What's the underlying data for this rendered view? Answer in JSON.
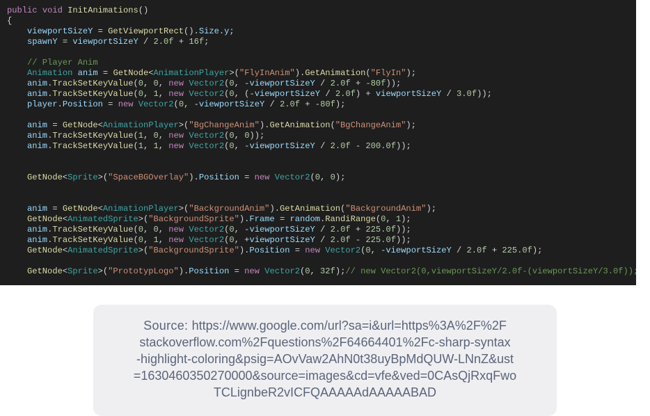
{
  "code": {
    "method_sig": {
      "mod": "public",
      "ret": "void",
      "name": "InitAnimations"
    },
    "lines": [
      {
        "i": 0,
        "t": "sig"
      },
      {
        "i": 0,
        "t": "brace_open"
      },
      {
        "i": 1,
        "t": "assign",
        "lhs": "viewportSizeY",
        "rhs": [
          [
            "fn",
            "GetViewportRect"
          ],
          [
            "pun",
            "()."
          ],
          [
            "var",
            "Size"
          ],
          [
            "pun",
            "."
          ],
          [
            "var",
            "y"
          ],
          [
            "pun",
            ";"
          ]
        ]
      },
      {
        "i": 1,
        "t": "assign",
        "lhs": "spawnY",
        "rhs": [
          [
            "var",
            "viewportSizeY"
          ],
          [
            "pun",
            " / "
          ],
          [
            "num",
            "2.0f"
          ],
          [
            "pun",
            " + "
          ],
          [
            "num",
            "16f"
          ],
          [
            "pun",
            ";"
          ]
        ]
      },
      {
        "i": 1,
        "t": "blank"
      },
      {
        "i": 1,
        "t": "comment",
        "text": "// Player Anim"
      },
      {
        "i": 1,
        "t": "raw",
        "tok": [
          [
            "type",
            "Animation"
          ],
          [
            "pun",
            " "
          ],
          [
            "var",
            "anim"
          ],
          [
            "pun",
            " = "
          ],
          [
            "fn",
            "GetNode"
          ],
          [
            "pun",
            "<"
          ],
          [
            "type",
            "AnimationPlayer"
          ],
          [
            "pun",
            ">("
          ],
          [
            "str",
            "\"FlyInAnim\""
          ],
          [
            "pun",
            ")."
          ],
          [
            "fn",
            "GetAnimation"
          ],
          [
            "pun",
            "("
          ],
          [
            "str",
            "\"FlyIn\""
          ],
          [
            "pun",
            ");"
          ]
        ]
      },
      {
        "i": 1,
        "t": "raw",
        "tok": [
          [
            "var",
            "anim"
          ],
          [
            "pun",
            "."
          ],
          [
            "fn",
            "TrackSetKeyValue"
          ],
          [
            "pun",
            "("
          ],
          [
            "num",
            "0"
          ],
          [
            "pun",
            ", "
          ],
          [
            "num",
            "0"
          ],
          [
            "pun",
            ", "
          ],
          [
            "kw",
            "new"
          ],
          [
            "pun",
            " "
          ],
          [
            "type",
            "Vector2"
          ],
          [
            "pun",
            "("
          ],
          [
            "num",
            "0"
          ],
          [
            "pun",
            ", -"
          ],
          [
            "var",
            "viewportSizeY"
          ],
          [
            "pun",
            " / "
          ],
          [
            "num",
            "2.0f"
          ],
          [
            "pun",
            " + -"
          ],
          [
            "num",
            "80f"
          ],
          [
            "pun",
            "));"
          ]
        ]
      },
      {
        "i": 1,
        "t": "raw",
        "tok": [
          [
            "var",
            "anim"
          ],
          [
            "pun",
            "."
          ],
          [
            "fn",
            "TrackSetKeyValue"
          ],
          [
            "pun",
            "("
          ],
          [
            "num",
            "0"
          ],
          [
            "pun",
            ", "
          ],
          [
            "num",
            "1"
          ],
          [
            "pun",
            ", "
          ],
          [
            "kw",
            "new"
          ],
          [
            "pun",
            " "
          ],
          [
            "type",
            "Vector2"
          ],
          [
            "pun",
            "("
          ],
          [
            "num",
            "0"
          ],
          [
            "pun",
            ", (-"
          ],
          [
            "var",
            "viewportSizeY"
          ],
          [
            "pun",
            " / "
          ],
          [
            "num",
            "2.0f"
          ],
          [
            "pun",
            ") + "
          ],
          [
            "var",
            "viewportSizeY"
          ],
          [
            "pun",
            " / "
          ],
          [
            "num",
            "3.0f"
          ],
          [
            "pun",
            "));"
          ]
        ]
      },
      {
        "i": 1,
        "t": "raw",
        "tok": [
          [
            "var",
            "player"
          ],
          [
            "pun",
            "."
          ],
          [
            "var",
            "Position"
          ],
          [
            "pun",
            " = "
          ],
          [
            "kw",
            "new"
          ],
          [
            "pun",
            " "
          ],
          [
            "type",
            "Vector2"
          ],
          [
            "pun",
            "("
          ],
          [
            "num",
            "0"
          ],
          [
            "pun",
            ", -"
          ],
          [
            "var",
            "viewportSizeY"
          ],
          [
            "pun",
            " / "
          ],
          [
            "num",
            "2.0f"
          ],
          [
            "pun",
            " + -"
          ],
          [
            "num",
            "80f"
          ],
          [
            "pun",
            ");"
          ]
        ]
      },
      {
        "i": 1,
        "t": "blank"
      },
      {
        "i": 1,
        "t": "raw",
        "tok": [
          [
            "var",
            "anim"
          ],
          [
            "pun",
            " = "
          ],
          [
            "fn",
            "GetNode"
          ],
          [
            "pun",
            "<"
          ],
          [
            "type",
            "AnimationPlayer"
          ],
          [
            "pun",
            ">("
          ],
          [
            "str",
            "\"BgChangeAnim\""
          ],
          [
            "pun",
            ")."
          ],
          [
            "fn",
            "GetAnimation"
          ],
          [
            "pun",
            "("
          ],
          [
            "str",
            "\"BgChangeAnim\""
          ],
          [
            "pun",
            ");"
          ]
        ]
      },
      {
        "i": 1,
        "t": "raw",
        "tok": [
          [
            "var",
            "anim"
          ],
          [
            "pun",
            "."
          ],
          [
            "fn",
            "TrackSetKeyValue"
          ],
          [
            "pun",
            "("
          ],
          [
            "num",
            "1"
          ],
          [
            "pun",
            ", "
          ],
          [
            "num",
            "0"
          ],
          [
            "pun",
            ", "
          ],
          [
            "kw",
            "new"
          ],
          [
            "pun",
            " "
          ],
          [
            "type",
            "Vector2"
          ],
          [
            "pun",
            "("
          ],
          [
            "num",
            "0"
          ],
          [
            "pun",
            ", "
          ],
          [
            "num",
            "0"
          ],
          [
            "pun",
            "));"
          ]
        ]
      },
      {
        "i": 1,
        "t": "raw",
        "tok": [
          [
            "var",
            "anim"
          ],
          [
            "pun",
            "."
          ],
          [
            "fn",
            "TrackSetKeyValue"
          ],
          [
            "pun",
            "("
          ],
          [
            "num",
            "1"
          ],
          [
            "pun",
            ", "
          ],
          [
            "num",
            "1"
          ],
          [
            "pun",
            ", "
          ],
          [
            "kw",
            "new"
          ],
          [
            "pun",
            " "
          ],
          [
            "type",
            "Vector2"
          ],
          [
            "pun",
            "("
          ],
          [
            "num",
            "0"
          ],
          [
            "pun",
            ", -"
          ],
          [
            "var",
            "viewportSizeY"
          ],
          [
            "pun",
            " / "
          ],
          [
            "num",
            "2.0f"
          ],
          [
            "pun",
            " - "
          ],
          [
            "num",
            "200.0f"
          ],
          [
            "pun",
            "));"
          ]
        ]
      },
      {
        "i": 1,
        "t": "blank"
      },
      {
        "i": 1,
        "t": "blank"
      },
      {
        "i": 1,
        "t": "raw",
        "tok": [
          [
            "fn",
            "GetNode"
          ],
          [
            "pun",
            "<"
          ],
          [
            "type",
            "Sprite"
          ],
          [
            "pun",
            ">("
          ],
          [
            "str",
            "\"SpaceBGOverlay\""
          ],
          [
            "pun",
            ")."
          ],
          [
            "var",
            "Position"
          ],
          [
            "pun",
            " = "
          ],
          [
            "kw",
            "new"
          ],
          [
            "pun",
            " "
          ],
          [
            "type",
            "Vector2"
          ],
          [
            "pun",
            "("
          ],
          [
            "num",
            "0"
          ],
          [
            "pun",
            ", "
          ],
          [
            "num",
            "0"
          ],
          [
            "pun",
            ");"
          ]
        ]
      },
      {
        "i": 1,
        "t": "blank"
      },
      {
        "i": 1,
        "t": "blank"
      },
      {
        "i": 1,
        "t": "raw",
        "tok": [
          [
            "var",
            "anim"
          ],
          [
            "pun",
            " = "
          ],
          [
            "fn",
            "GetNode"
          ],
          [
            "pun",
            "<"
          ],
          [
            "type",
            "AnimationPlayer"
          ],
          [
            "pun",
            ">("
          ],
          [
            "str",
            "\"BackgroundAnim\""
          ],
          [
            "pun",
            ")."
          ],
          [
            "fn",
            "GetAnimation"
          ],
          [
            "pun",
            "("
          ],
          [
            "str",
            "\"BackgroundAnim\""
          ],
          [
            "pun",
            ");"
          ]
        ]
      },
      {
        "i": 1,
        "t": "raw",
        "tok": [
          [
            "fn",
            "GetNode"
          ],
          [
            "pun",
            "<"
          ],
          [
            "type",
            "AnimatedSprite"
          ],
          [
            "pun",
            ">("
          ],
          [
            "str",
            "\"BackgroundSprite\""
          ],
          [
            "pun",
            ")."
          ],
          [
            "var",
            "Frame"
          ],
          [
            "pun",
            " = "
          ],
          [
            "var",
            "random"
          ],
          [
            "pun",
            "."
          ],
          [
            "fn",
            "RandiRange"
          ],
          [
            "pun",
            "("
          ],
          [
            "num",
            "0"
          ],
          [
            "pun",
            ", "
          ],
          [
            "num",
            "1"
          ],
          [
            "pun",
            ");"
          ]
        ]
      },
      {
        "i": 1,
        "t": "raw",
        "tok": [
          [
            "var",
            "anim"
          ],
          [
            "pun",
            "."
          ],
          [
            "fn",
            "TrackSetKeyValue"
          ],
          [
            "pun",
            "("
          ],
          [
            "num",
            "0"
          ],
          [
            "pun",
            ", "
          ],
          [
            "num",
            "0"
          ],
          [
            "pun",
            ", "
          ],
          [
            "kw",
            "new"
          ],
          [
            "pun",
            " "
          ],
          [
            "type",
            "Vector2"
          ],
          [
            "pun",
            "("
          ],
          [
            "num",
            "0"
          ],
          [
            "pun",
            ", -"
          ],
          [
            "var",
            "viewportSizeY"
          ],
          [
            "pun",
            " / "
          ],
          [
            "num",
            "2.0f"
          ],
          [
            "pun",
            " + "
          ],
          [
            "num",
            "225.0f"
          ],
          [
            "pun",
            "));"
          ]
        ]
      },
      {
        "i": 1,
        "t": "raw",
        "tok": [
          [
            "var",
            "anim"
          ],
          [
            "pun",
            "."
          ],
          [
            "fn",
            "TrackSetKeyValue"
          ],
          [
            "pun",
            "("
          ],
          [
            "num",
            "0"
          ],
          [
            "pun",
            ", "
          ],
          [
            "num",
            "1"
          ],
          [
            "pun",
            ", "
          ],
          [
            "kw",
            "new"
          ],
          [
            "pun",
            " "
          ],
          [
            "type",
            "Vector2"
          ],
          [
            "pun",
            "("
          ],
          [
            "num",
            "0"
          ],
          [
            "pun",
            ", +"
          ],
          [
            "var",
            "viewportSizeY"
          ],
          [
            "pun",
            " / "
          ],
          [
            "num",
            "2.0f"
          ],
          [
            "pun",
            " - "
          ],
          [
            "num",
            "225.0f"
          ],
          [
            "pun",
            "));"
          ]
        ]
      },
      {
        "i": 1,
        "t": "raw",
        "tok": [
          [
            "fn",
            "GetNode"
          ],
          [
            "pun",
            "<"
          ],
          [
            "type",
            "AnimatedSprite"
          ],
          [
            "pun",
            ">("
          ],
          [
            "str",
            "\"BackgroundSprite\""
          ],
          [
            "pun",
            ")."
          ],
          [
            "var",
            "Position"
          ],
          [
            "pun",
            " = "
          ],
          [
            "kw",
            "new"
          ],
          [
            "pun",
            " "
          ],
          [
            "type",
            "Vector2"
          ],
          [
            "pun",
            "("
          ],
          [
            "num",
            "0"
          ],
          [
            "pun",
            ", -"
          ],
          [
            "var",
            "viewportSizeY"
          ],
          [
            "pun",
            " / "
          ],
          [
            "num",
            "2.0f"
          ],
          [
            "pun",
            " + "
          ],
          [
            "num",
            "225.0f"
          ],
          [
            "pun",
            ");"
          ]
        ]
      },
      {
        "i": 1,
        "t": "blank"
      },
      {
        "i": 1,
        "t": "raw",
        "tok": [
          [
            "fn",
            "GetNode"
          ],
          [
            "pun",
            "<"
          ],
          [
            "type",
            "Sprite"
          ],
          [
            "pun",
            ">("
          ],
          [
            "str",
            "\"PrototypLogo\""
          ],
          [
            "pun",
            ")."
          ],
          [
            "var",
            "Position"
          ],
          [
            "pun",
            " = "
          ],
          [
            "kw",
            "new"
          ],
          [
            "pun",
            " "
          ],
          [
            "type",
            "Vector2"
          ],
          [
            "pun",
            "("
          ],
          [
            "num",
            "0"
          ],
          [
            "pun",
            ", "
          ],
          [
            "num",
            "32f"
          ],
          [
            "pun",
            ");"
          ],
          [
            "com",
            "// new Vector2(0,viewportSizeY/2.0f-(viewportSizeY/3.0f));"
          ]
        ]
      },
      {
        "i": 1,
        "t": "blank"
      },
      {
        "i": 0,
        "t": "brace_close"
      }
    ]
  },
  "source": {
    "label": "Source:  ",
    "lines": [
      "https://www.google.com/url?sa=i&url=https%3A%2F%2F",
      "stackoverflow.com%2Fquestions%2F64664401%2Fc-sharp-syntax",
      "-highlight-coloring&psig=AOvVaw2AhN0t38uyBpMdQUW-LNnZ&ust",
      "=1630460350270000&source=images&cd=vfe&ved=0CAsQjRxqFwo",
      "TCLignbeR2vICFQAAAAAdAAAAABAD"
    ]
  }
}
